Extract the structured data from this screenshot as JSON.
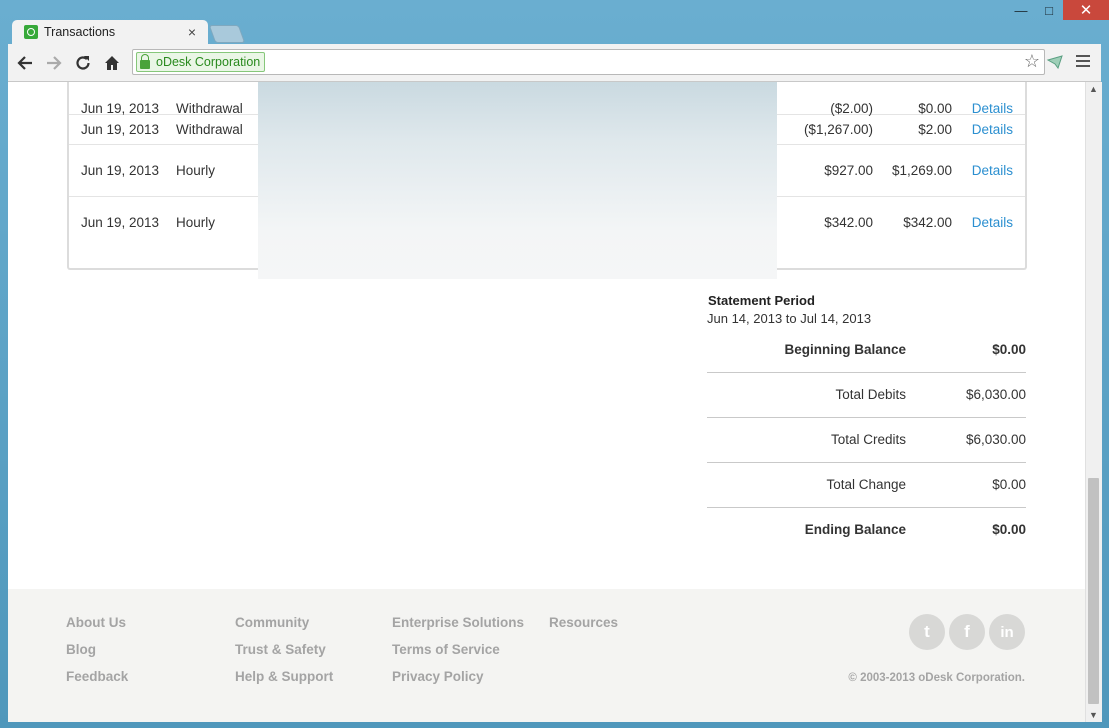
{
  "browser": {
    "tab_title": "Transactions",
    "tab_close": "×",
    "address_ev_label": "oDesk Corporation",
    "window_controls": {
      "minimize": "—",
      "maximize": "□",
      "close": "✕"
    },
    "icons": [
      "back-icon",
      "forward-icon",
      "reload-icon",
      "home-icon",
      "lock-icon",
      "star-icon",
      "extension-icon",
      "menu-icon"
    ]
  },
  "transactions": [
    {
      "date": "Jun 19, 2013",
      "type": "Withdrawal",
      "amount": "($2.00)",
      "balance": "$0.00",
      "link": "Details"
    },
    {
      "date": "Jun 19, 2013",
      "type": "Withdrawal",
      "amount": "($1,267.00)",
      "balance": "$2.00",
      "link": "Details"
    },
    {
      "date": "Jun 19, 2013",
      "type": "Hourly",
      "amount": "$927.00",
      "balance": "$1,269.00",
      "link": "Details"
    },
    {
      "date": "Jun 19, 2013",
      "type": "Hourly",
      "amount": "$342.00",
      "balance": "$342.00",
      "link": "Details"
    }
  ],
  "statement": {
    "title": "Statement Period",
    "range": "Jun 14, 2013 to Jul 14, 2013",
    "beginning_label": "Beginning Balance",
    "beginning_value": "$0.00",
    "debits_label": "Total Debits",
    "debits_value": "$6,030.00",
    "credits_label": "Total Credits",
    "credits_value": "$6,030.00",
    "change_label": "Total Change",
    "change_value": "$0.00",
    "ending_label": "Ending Balance",
    "ending_value": "$0.00"
  },
  "footer": {
    "col1": [
      "About Us",
      "Blog",
      "Feedback"
    ],
    "col2": [
      "Community",
      "Trust & Safety",
      "Help & Support"
    ],
    "col3": [
      "Enterprise Solutions",
      "Terms of Service",
      "Privacy Policy"
    ],
    "col4": [
      "Resources"
    ],
    "social": {
      "twitter": "t",
      "facebook": "f",
      "linkedin": "in"
    },
    "copyright": "© 2003-2013 oDesk Corporation."
  },
  "colors": {
    "link": "#2b8fd0",
    "ev_green": "#2a8a1e",
    "close_button": "#c9483c"
  }
}
